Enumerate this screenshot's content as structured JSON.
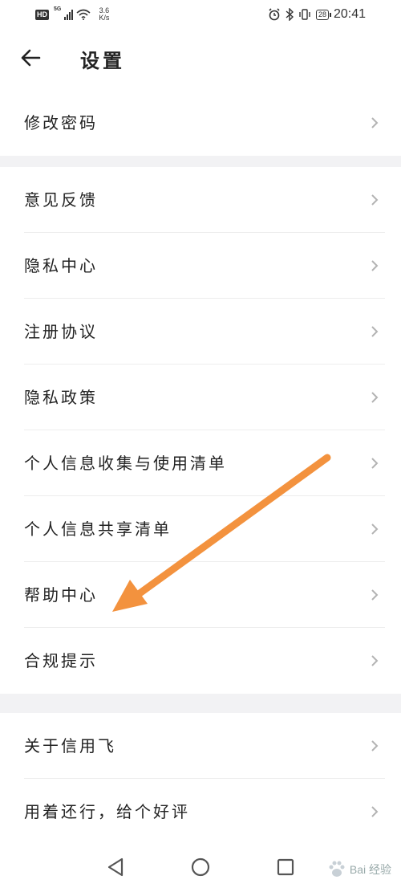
{
  "status_bar": {
    "network_badge": "HD",
    "network_type": "5G",
    "speed_value": "3.6",
    "speed_unit": "K/s",
    "battery": "28",
    "time": "20:41"
  },
  "header": {
    "title": "设置"
  },
  "sections": [
    {
      "items": [
        {
          "label": "修改密码"
        }
      ]
    },
    {
      "items": [
        {
          "label": "意见反馈"
        },
        {
          "label": "隐私中心"
        },
        {
          "label": "注册协议"
        },
        {
          "label": "隐私政策"
        },
        {
          "label": "个人信息收集与使用清单"
        },
        {
          "label": "个人信息共享清单"
        },
        {
          "label": "帮助中心"
        },
        {
          "label": "合规提示"
        }
      ]
    },
    {
      "items": [
        {
          "label": "关于信用飞"
        },
        {
          "label": "用着还行，给个好评"
        }
      ]
    }
  ],
  "annotation": {
    "color": "#f3923e",
    "points_to": "帮助中心"
  },
  "watermark": {
    "text": "Bai 经验"
  }
}
